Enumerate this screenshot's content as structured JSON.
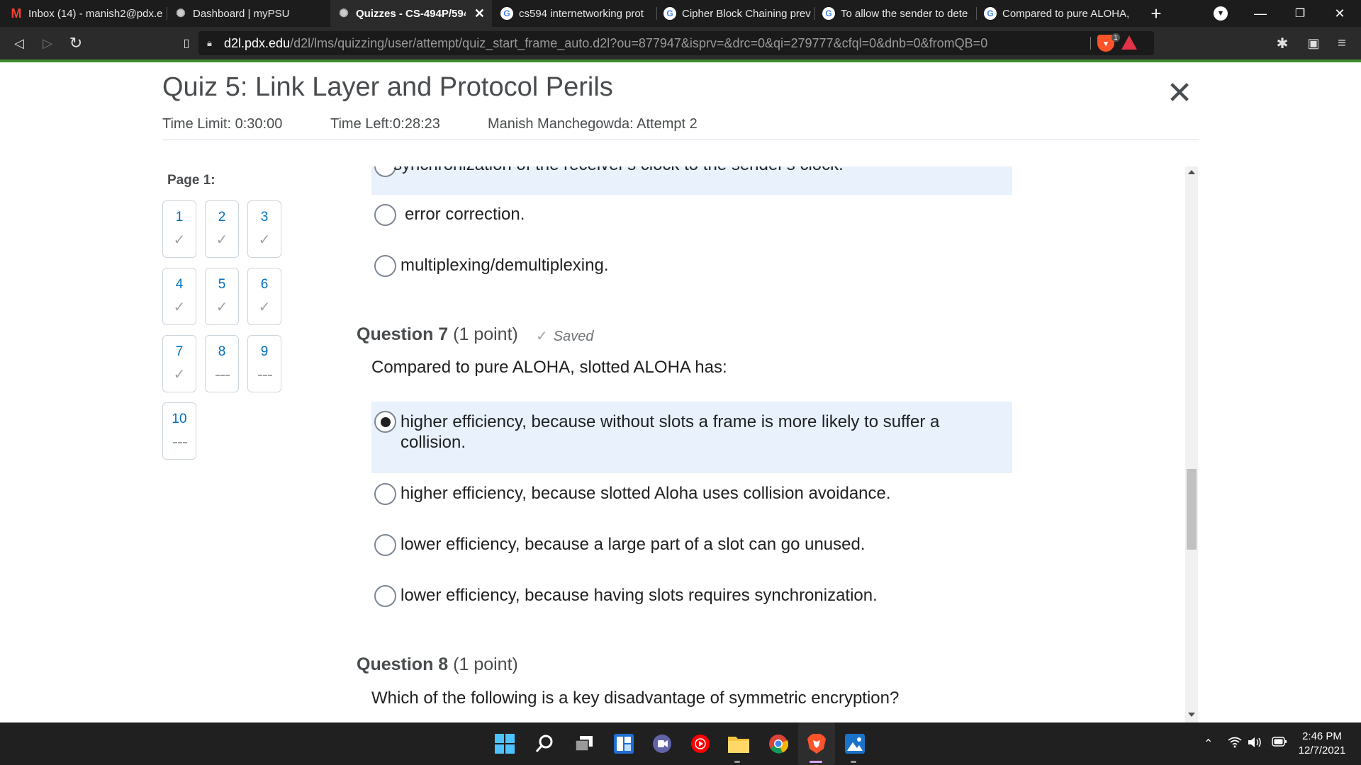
{
  "browser": {
    "tabs": [
      {
        "title": "Inbox (14) - manish2@pdx.e",
        "icon": "gmail-icon"
      },
      {
        "title": "Dashboard | myPSU",
        "icon": "d2l-icon"
      },
      {
        "title": "Quizzes - CS-494P/594",
        "icon": "d2l-icon",
        "active": true
      },
      {
        "title": "cs594 internetworking prot",
        "icon": "google-icon"
      },
      {
        "title": "Cipher Block Chaining prev",
        "icon": "google-icon"
      },
      {
        "title": "To allow the sender to dete",
        "icon": "google-icon"
      },
      {
        "title": "Compared to pure ALOHA,",
        "icon": "google-icon"
      }
    ],
    "url_host": "d2l.pdx.edu",
    "url_path": "/d2l/lms/quizzing/user/attempt/quiz_start_frame_auto.d2l?ou=877947&isprv=&drc=0&qi=279777&cfql=0&dnb=0&fromQB=0",
    "shield_count": "1"
  },
  "quiz": {
    "title": "Quiz 5: Link Layer and Protocol Perils",
    "time_limit": "Time Limit: 0:30:00",
    "time_left": "Time Left:0:28:23",
    "attempt": "Manish Manchegowda: Attempt 2",
    "page_label": "Page 1:",
    "nav_tiles": [
      {
        "num": "1",
        "answered": true
      },
      {
        "num": "2",
        "answered": true
      },
      {
        "num": "3",
        "answered": true
      },
      {
        "num": "4",
        "answered": true
      },
      {
        "num": "5",
        "answered": true
      },
      {
        "num": "6",
        "answered": true
      },
      {
        "num": "7",
        "answered": true
      },
      {
        "num": "8",
        "answered": false
      },
      {
        "num": "9",
        "answered": false
      },
      {
        "num": "10",
        "answered": false
      }
    ]
  },
  "question6_tail": {
    "cut_option": "synchronization of the receiver's clock to the sender's clock.",
    "options": [
      "error correction.",
      "multiplexing/demultiplexing."
    ]
  },
  "question7": {
    "label": "Question 7",
    "points": "(1 point)",
    "saved": "Saved",
    "text": "Compared to pure ALOHA, slotted ALOHA has:",
    "options": [
      {
        "line1": "higher efficiency, because without slots a frame is more likely to suffer a",
        "line2": "collision.",
        "selected": true
      },
      {
        "line1": "higher efficiency, because slotted Aloha uses collision avoidance.",
        "selected": false
      },
      {
        "line1": "lower efficiency, because a large part of a slot can go unused.",
        "selected": false
      },
      {
        "line1": "lower efficiency, because having slots requires synchronization.",
        "selected": false
      }
    ]
  },
  "question8": {
    "label": "Question 8",
    "points": "(1 point)",
    "text": "Which of the following is a key disadvantage of symmetric encryption?"
  },
  "taskbar": {
    "time": "2:46 PM",
    "date": "12/7/2021",
    "apps": [
      "start-icon",
      "search-icon",
      "task-view-icon",
      "widgets-icon",
      "teams-chat-icon",
      "youtube-music-icon",
      "file-explorer-icon",
      "chrome-icon",
      "brave-icon",
      "photos-icon"
    ]
  }
}
